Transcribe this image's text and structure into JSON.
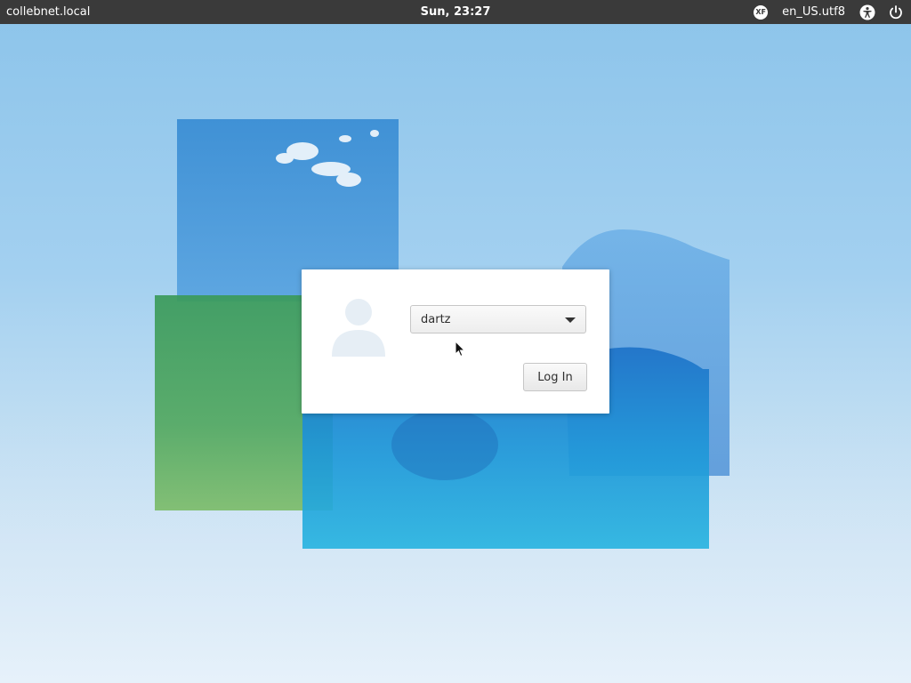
{
  "topbar": {
    "hostname": "collebnet.local",
    "clock": "Sun, 23:27",
    "keyboard_badge": "XF",
    "locale": "en_US.utf8",
    "icons": [
      "keyboard-layout-icon",
      "accessibility-icon",
      "power-icon"
    ]
  },
  "login": {
    "avatar_icon": "user-avatar-icon",
    "selected_user": "dartz",
    "user_options": [
      "dartz"
    ],
    "login_button": "Log In"
  },
  "colors": {
    "topbar_bg": "#3a3a3a",
    "dialog_bg": "#ffffff",
    "sky_blue": "#8cc4ea"
  }
}
